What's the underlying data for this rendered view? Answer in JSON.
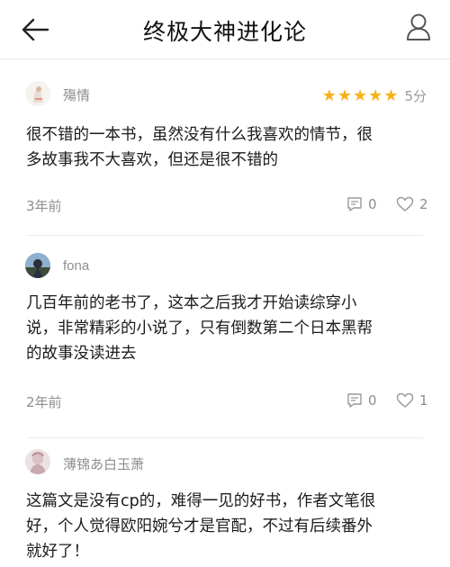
{
  "header": {
    "title": "终极大神进化论",
    "back_icon": "arrow-left-icon",
    "profile_icon": "user-icon"
  },
  "comments": [
    {
      "username": "殤情",
      "rating_stars": 5,
      "rating_text": "5分",
      "text_lines": [
        "很不错的一本书，虽然没有什么我喜欢的情节，很",
        "多故事我不大喜欢，但还是很不错的"
      ],
      "time": "3年前",
      "reply_count": "0",
      "like_count": "2"
    },
    {
      "username": "fona",
      "text_lines": [
        "几百年前的老书了，这本之后我才开始读综穿小",
        "说，非常精彩的小说了，只有倒数第二个日本黑帮",
        "的故事没读进去"
      ],
      "time": "2年前",
      "reply_count": "0",
      "like_count": "1"
    },
    {
      "username": "薄锦あ白玉萧",
      "text_lines": [
        "这篇文是没有cp的，难得一见的好书，作者文笔很",
        "好，个人觉得欧阳婉兮才是官配，不过有后续番外",
        "就好了！"
      ]
    }
  ],
  "colors": {
    "star": "#f5b316",
    "secondary_text": "#8e8e8e",
    "divider": "#ececec"
  }
}
